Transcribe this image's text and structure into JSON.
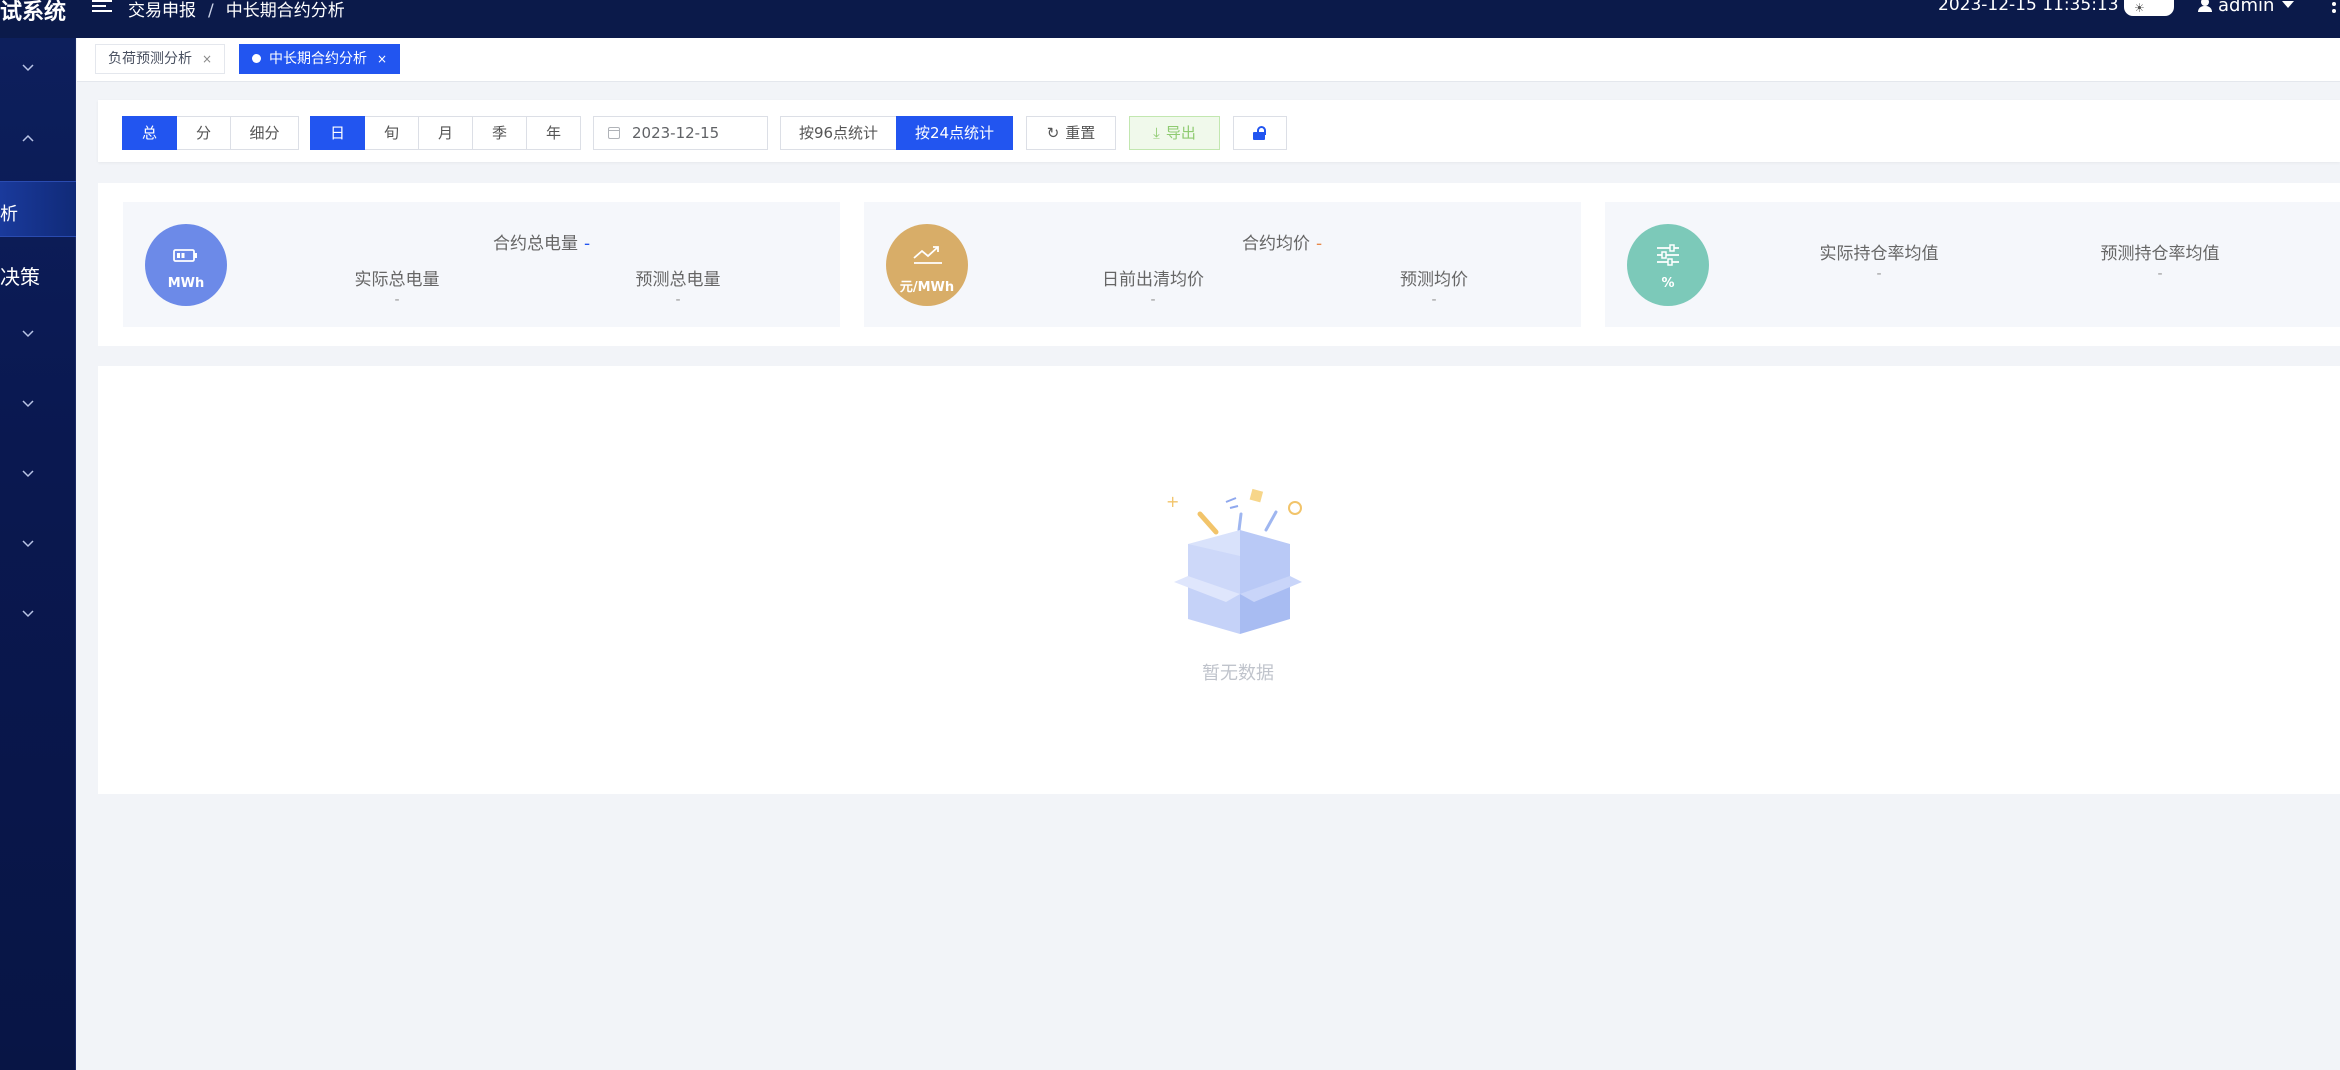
{
  "header": {
    "system_title": "试系统",
    "breadcrumb": [
      "交易申报",
      "中长期合约分析"
    ],
    "datetime": "2023-12-15 11:35:13",
    "user": "admin"
  },
  "sidebar": {
    "active_item": "析",
    "item_decision": "决策"
  },
  "tabs": [
    {
      "label": "负荷预测分析",
      "active": false
    },
    {
      "label": "中长期合约分析",
      "active": true
    }
  ],
  "toolbar": {
    "scope_options": [
      "总",
      "分",
      "细分"
    ],
    "scope_selected": "总",
    "period_options": [
      "日",
      "旬",
      "月",
      "季",
      "年"
    ],
    "period_selected": "日",
    "date_value": "2023-12-15",
    "stat_options": [
      "按96点统计",
      "按24点统计"
    ],
    "stat_selected": "按24点统计",
    "reset_label": "重置",
    "export_label": "导出"
  },
  "stats": [
    {
      "unit": "MWh",
      "color": "#6c8ae8",
      "title": "合约总电量",
      "title_value": "-",
      "items": [
        {
          "label": "实际总电量",
          "value": "-"
        },
        {
          "label": "预测总电量",
          "value": "-"
        }
      ]
    },
    {
      "unit": "元/MWh",
      "color": "#d8ad68",
      "title": "合约均价",
      "title_value": "-",
      "items": [
        {
          "label": "日前出清均价",
          "value": "-"
        },
        {
          "label": "预测均价",
          "value": "-"
        }
      ]
    },
    {
      "unit": "%",
      "color": "#7cc9b9",
      "items": [
        {
          "label": "实际持仓率均值",
          "value": "-"
        },
        {
          "label": "预测持仓率均值",
          "value": "-"
        }
      ]
    }
  ],
  "empty_state": {
    "text": "暂无数据"
  },
  "colors": {
    "primary": "#2255f0",
    "header_bg": "#0b1a4a",
    "export_text": "#8fcb71"
  }
}
